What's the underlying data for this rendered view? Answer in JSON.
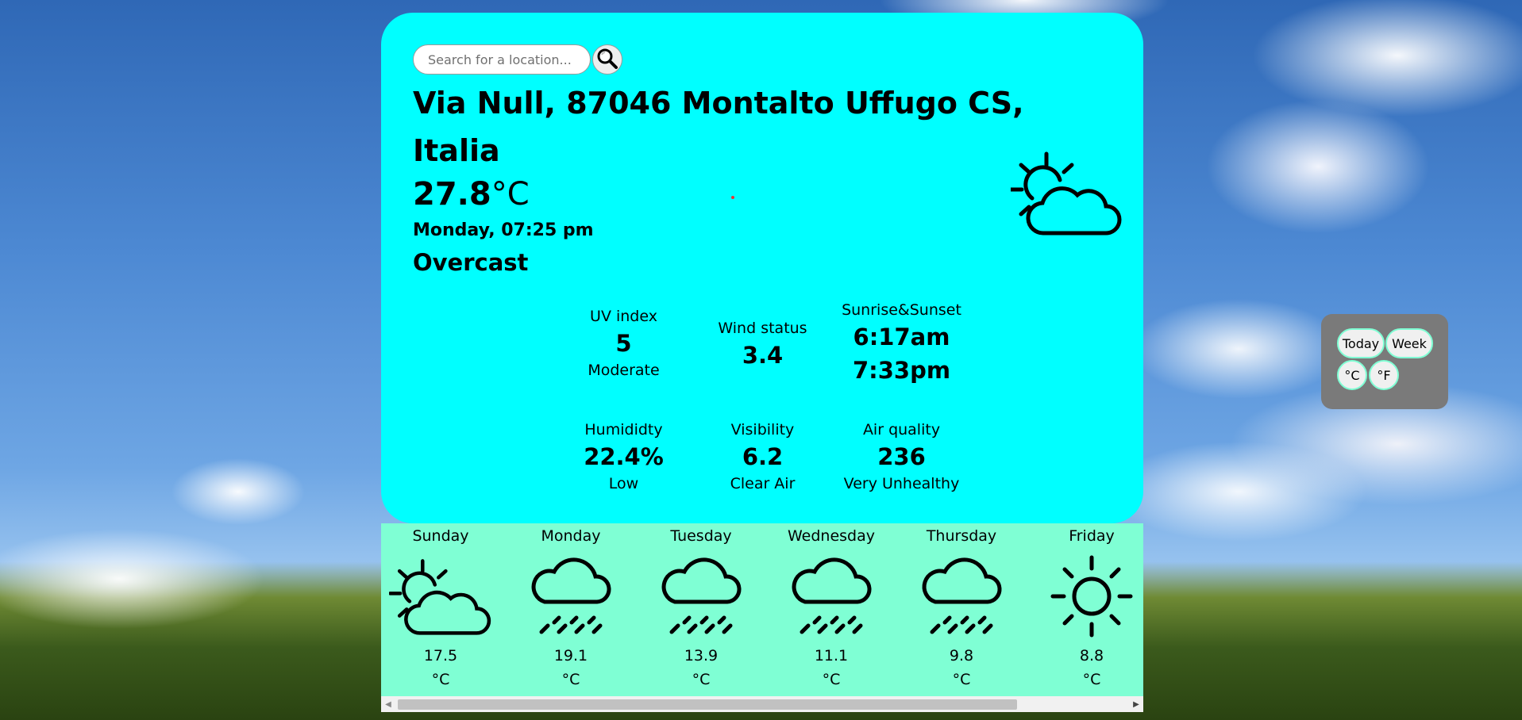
{
  "search": {
    "placeholder": "Search for a location..."
  },
  "location": "Via Null, 87046 Montalto Uffugo CS, Italia",
  "current": {
    "temp_value": "27.8",
    "temp_unit": "°C",
    "datetime": "Monday, 07:25 pm",
    "condition": "Overcast",
    "icon": "partly-cloudy-icon"
  },
  "highlights": {
    "uv": {
      "label": "UV index",
      "value": "5",
      "status": "Moderate"
    },
    "wind": {
      "label": "Wind status",
      "value": "3.4"
    },
    "sun": {
      "label": "Sunrise&Sunset",
      "sunrise": "6:17am",
      "sunset": "7:33pm"
    },
    "humidity": {
      "label": "Humididty",
      "value": "22.4%",
      "status": "Low"
    },
    "visibility": {
      "label": "Visibility",
      "value": "6.2",
      "status": "Clear Air"
    },
    "air": {
      "label": "Air quality",
      "value": "236",
      "status": "Very Unhealthy"
    }
  },
  "forecast": [
    {
      "day": "Sunday",
      "temp": "17.5",
      "unit": "°C",
      "icon": "partly-cloudy-icon"
    },
    {
      "day": "Monday",
      "temp": "19.1",
      "unit": "°C",
      "icon": "rain-cloud-icon"
    },
    {
      "day": "Tuesday",
      "temp": "13.9",
      "unit": "°C",
      "icon": "rain-cloud-icon"
    },
    {
      "day": "Wednesday",
      "temp": "11.1",
      "unit": "°C",
      "icon": "rain-cloud-icon"
    },
    {
      "day": "Thursday",
      "temp": "9.8",
      "unit": "°C",
      "icon": "rain-cloud-icon"
    },
    {
      "day": "Friday",
      "temp": "8.8",
      "unit": "°C",
      "icon": "sun-icon"
    }
  ],
  "controls": {
    "today": "Today",
    "week": "Week",
    "celsius": "°C",
    "fahrenheit": "°F"
  },
  "colors": {
    "card": "#00ffff",
    "forecast_strip": "#7fffd4",
    "controls_panel": "#7a7a7a"
  }
}
